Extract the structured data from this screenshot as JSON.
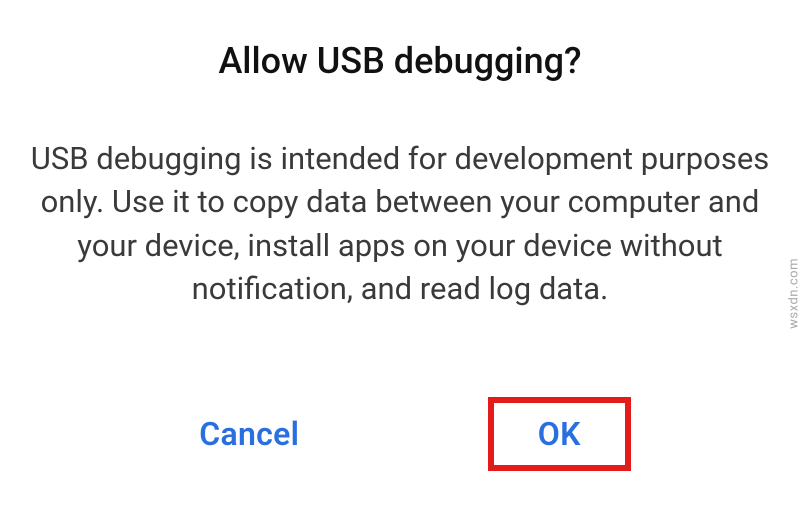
{
  "dialog": {
    "title": "Allow USB debugging?",
    "message": "USB debugging is intended for development purposes only. Use it to copy data between your computer and your device, install apps on your device without notification, and read log data.",
    "actions": {
      "cancel": "Cancel",
      "ok": "OK"
    }
  },
  "watermark": "wsxdn.com",
  "highlight": {
    "color": "#e41b1b"
  }
}
